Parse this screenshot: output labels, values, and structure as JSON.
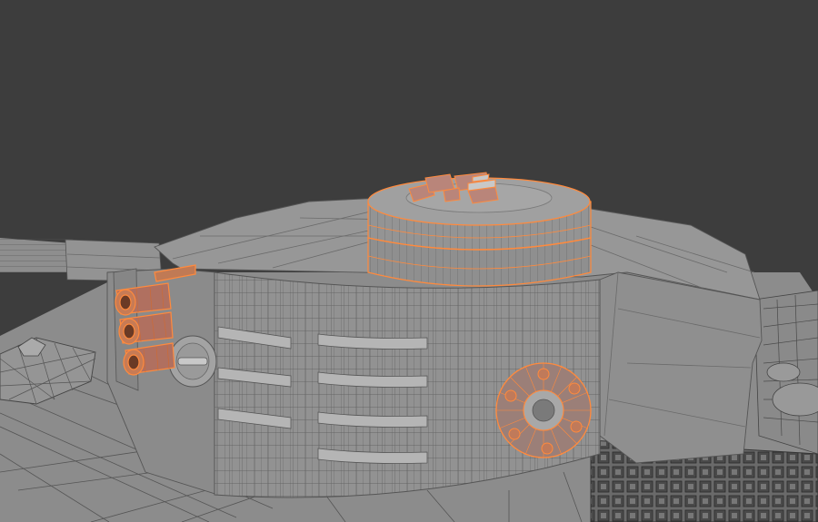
{
  "viewport": {
    "background_color": "#3d3d3d",
    "mode": "edit-mode-wireframe-overlay"
  },
  "scene": {
    "object": "tank-turret",
    "mesh_color": "#8f8f8f",
    "wire_color": "#2e2e2e",
    "selection_color": "#ff8a3d",
    "selected_parts": [
      "commander-cupola",
      "smoke-dischargers",
      "side-hatch-ring"
    ]
  }
}
